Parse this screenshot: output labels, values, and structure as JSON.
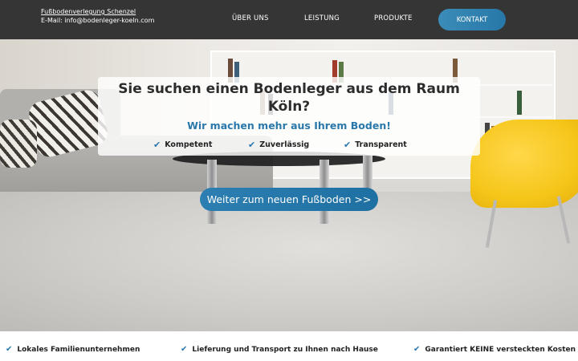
{
  "header": {
    "company": "Fußbodenverlegung Schenzel",
    "email": "E-Mail: info@bodenleger-koeln.com",
    "nav": {
      "ueber_uns": "ÜBER UNS",
      "leistung": "LEISTUNG",
      "produkte": "PRODUKTE",
      "kontakt": "KONTAKT"
    }
  },
  "hero": {
    "headline_line1": "Sie suchen einen Bodenleger aus dem Raum",
    "headline_line2": "Köln?",
    "subline": "Wir machen mehr aus Ihrem Boden!",
    "features": [
      "Kompetent",
      "Zuverlässig",
      "Transparent"
    ],
    "cta": "Weiter zum neuen Fußboden >>"
  },
  "usps": [
    "Lokales Familienunternehmen",
    "Lieferung und Transport zu Ihnen nach Hause",
    "Garantiert KEINE versteckten Kosten"
  ],
  "icons": {
    "check": "check-icon"
  },
  "colors": {
    "header_bg": "#353535",
    "accent": "#2a78ab"
  }
}
